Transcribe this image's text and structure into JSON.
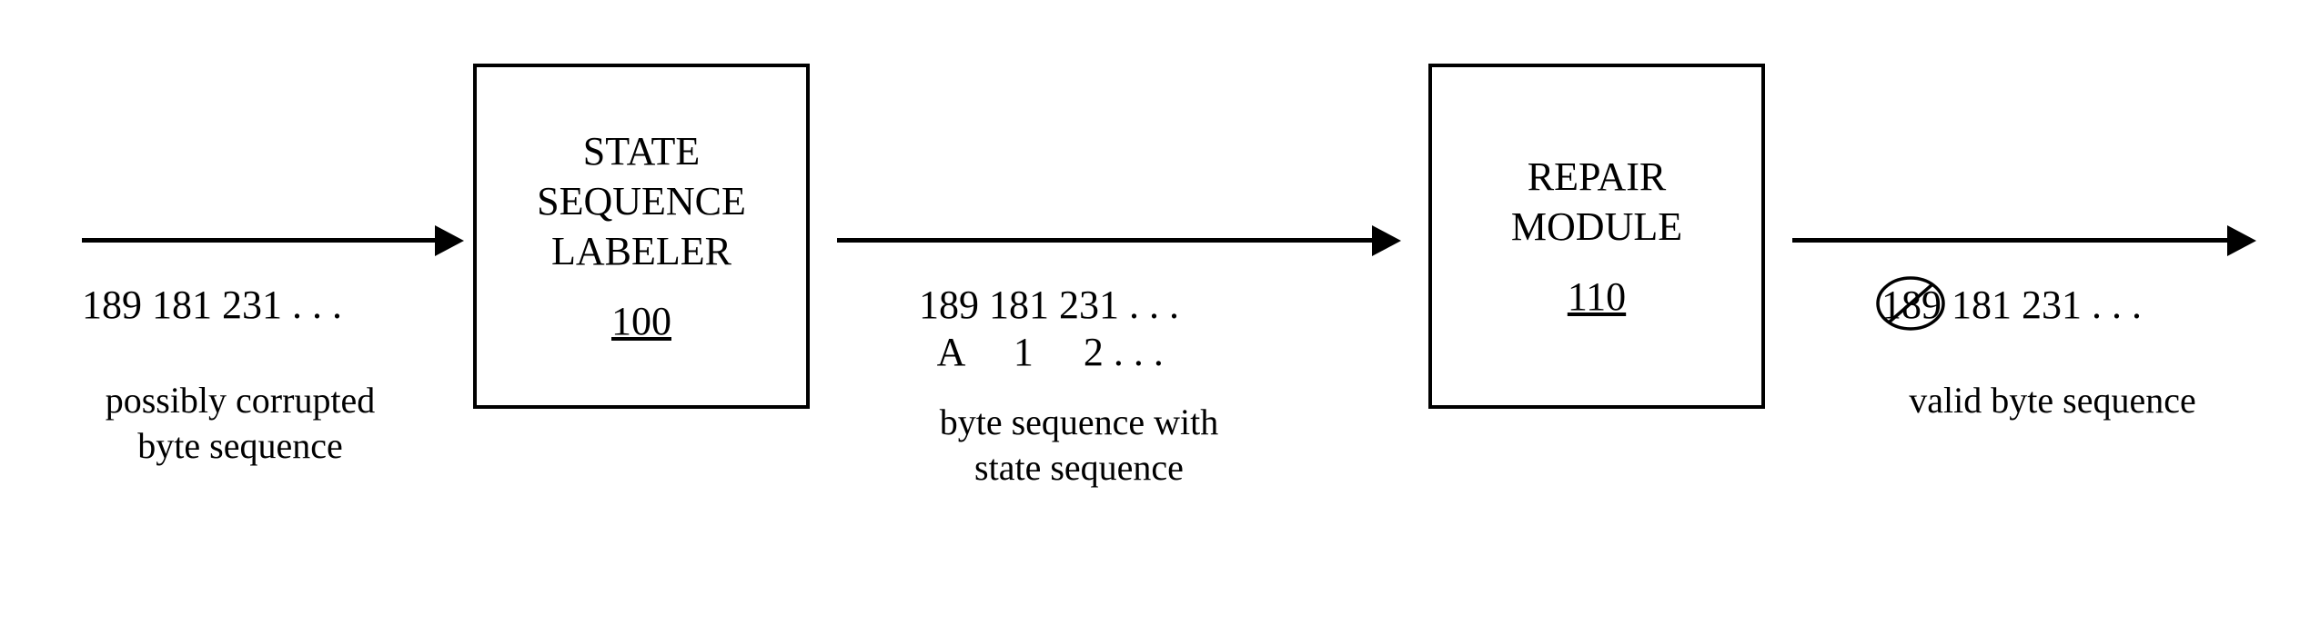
{
  "input": {
    "bytes": "189 181 231 . . .",
    "caption": "possibly corrupted\nbyte sequence"
  },
  "block1": {
    "title_line1": "STATE",
    "title_line2": "SEQUENCE",
    "title_line3": "LABELER",
    "ref": "100"
  },
  "middle": {
    "bytes": "189 181 231 . . .",
    "states": "  A     1     2 . . .",
    "caption": "byte sequence with\nstate sequence"
  },
  "block2": {
    "title_line1": "REPAIR",
    "title_line2": "MODULE",
    "ref": "110"
  },
  "output": {
    "removed_byte": "189",
    "remaining_bytes": " 181 231 . . .",
    "caption": "valid byte sequence"
  }
}
